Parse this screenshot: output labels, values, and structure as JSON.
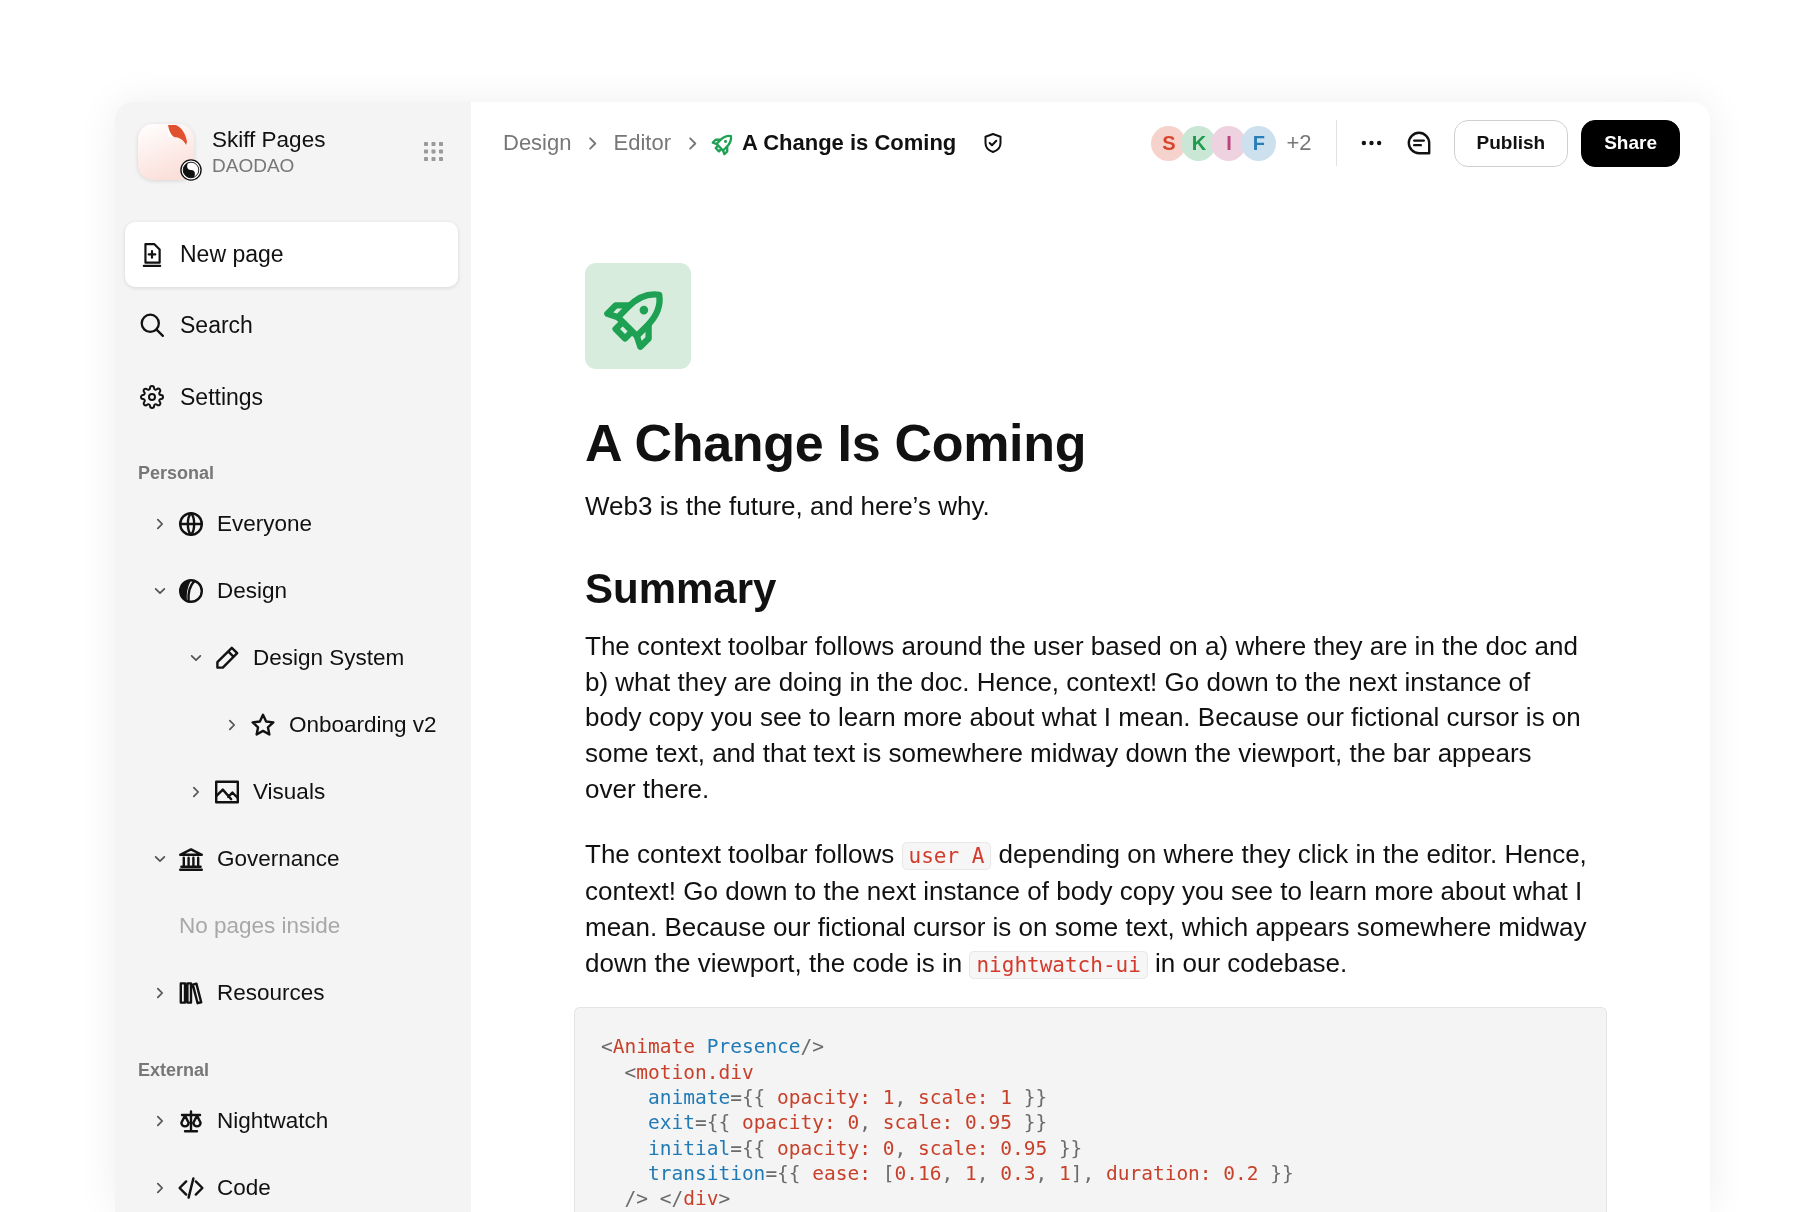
{
  "sidebar": {
    "workspace": {
      "name": "Skiff Pages",
      "org": "DAODAO"
    },
    "actions": [
      {
        "label": "New page",
        "kind": "card"
      },
      {
        "label": "Search",
        "kind": "plain"
      },
      {
        "label": "Settings",
        "kind": "plain"
      }
    ],
    "sections": [
      {
        "title": "Personal",
        "items": [
          {
            "label": "Everyone",
            "expanded": false
          },
          {
            "label": "Design",
            "expanded": true,
            "children": [
              {
                "label": "Design System",
                "expanded": true,
                "children": [
                  {
                    "label": "Onboarding v2",
                    "expanded": false
                  }
                ]
              },
              {
                "label": "Visuals",
                "expanded": false
              }
            ]
          },
          {
            "label": "Governance",
            "expanded": true,
            "empty_note": "No pages inside"
          },
          {
            "label": "Resources",
            "expanded": false
          }
        ]
      },
      {
        "title": "External",
        "items": [
          {
            "label": "Nightwatch",
            "expanded": false
          },
          {
            "label": "Code",
            "expanded": false
          }
        ]
      }
    ]
  },
  "topbar": {
    "breadcrumbs": [
      {
        "label": "Design",
        "current": false
      },
      {
        "label": "Editor",
        "current": false
      },
      {
        "label": "A Change is Coming",
        "current": true
      }
    ],
    "collaborators": [
      {
        "initial": "S",
        "color": "#d9452c"
      },
      {
        "initial": "K",
        "color": "#1e9a4c"
      },
      {
        "initial": "I",
        "color": "#b8447c"
      },
      {
        "initial": "F",
        "color": "#2b7db8"
      }
    ],
    "more_collaborators": "+2",
    "buttons": [
      {
        "label": "Publish",
        "kind": "outline"
      },
      {
        "label": "Share",
        "kind": "solid"
      }
    ]
  },
  "document": {
    "title": "A Change Is Coming",
    "subtitle": "Web3 is the future, and here’s why.",
    "heading": "Summary",
    "paragraphs": [
      {
        "segments": [
          {
            "kind": "text",
            "text": "The context toolbar follows around the user based on a) where they are in the doc and b) what they are doing in the doc. Hence, context! Go down to the next instance of body copy you see to learn more about what I mean. Because our fictional cursor is on some text, and that text is somewhere midway down the viewport, the bar appears over there."
          }
        ]
      },
      {
        "segments": [
          {
            "kind": "text",
            "text": "The context toolbar follows "
          },
          {
            "kind": "code",
            "text": "user A"
          },
          {
            "kind": "text",
            "text": " depending on where they click in the editor. Hence, context! Go down to the next instance of body copy you see to learn more about what I mean. Because our fictional cursor is on some text, which appears somewhere midway down the viewport, the code is in "
          },
          {
            "kind": "code",
            "text": "nightwatch-ui"
          },
          {
            "kind": "text",
            "text": " in our codebase."
          }
        ]
      }
    ],
    "code": [
      {
        "tokens": [
          {
            "kind": "punct",
            "text": "<"
          },
          {
            "kind": "tag",
            "text": "Animate"
          },
          {
            "kind": "attr",
            "text": " Presence"
          },
          {
            "kind": "punct",
            "text": "/>"
          }
        ]
      },
      {
        "tokens": [
          {
            "kind": "punct",
            "text": "  <"
          },
          {
            "kind": "tag",
            "text": "motion.div"
          }
        ]
      },
      {
        "tokens": [
          {
            "kind": "attr",
            "text": "    animate"
          },
          {
            "kind": "punct",
            "text": "={{ "
          },
          {
            "kind": "value",
            "text": "opacity: 1"
          },
          {
            "kind": "punct",
            "text": ", "
          },
          {
            "kind": "value",
            "text": "scale: 1"
          },
          {
            "kind": "punct",
            "text": " }}"
          }
        ]
      },
      {
        "tokens": [
          {
            "kind": "attr",
            "text": "    exit"
          },
          {
            "kind": "punct",
            "text": "={{ "
          },
          {
            "kind": "value",
            "text": "opacity: 0"
          },
          {
            "kind": "punct",
            "text": ", "
          },
          {
            "kind": "value",
            "text": "scale: 0.95"
          },
          {
            "kind": "punct",
            "text": " }}"
          }
        ]
      },
      {
        "tokens": [
          {
            "kind": "attr",
            "text": "    initial"
          },
          {
            "kind": "punct",
            "text": "={{ "
          },
          {
            "kind": "value",
            "text": "opacity: 0"
          },
          {
            "kind": "punct",
            "text": ", "
          },
          {
            "kind": "value",
            "text": "scale: 0.95"
          },
          {
            "kind": "punct",
            "text": " }}"
          }
        ]
      },
      {
        "tokens": [
          {
            "kind": "attr",
            "text": "    transition"
          },
          {
            "kind": "punct",
            "text": "={{ "
          },
          {
            "kind": "value",
            "text": "ease: "
          },
          {
            "kind": "punct",
            "text": "["
          },
          {
            "kind": "value",
            "text": "0.16"
          },
          {
            "kind": "punct",
            "text": ", "
          },
          {
            "kind": "value",
            "text": "1"
          },
          {
            "kind": "punct",
            "text": ", "
          },
          {
            "kind": "value",
            "text": "0.3"
          },
          {
            "kind": "punct",
            "text": ", "
          },
          {
            "kind": "value",
            "text": "1"
          },
          {
            "kind": "punct",
            "text": "], "
          },
          {
            "kind": "value",
            "text": "duration: 0.2"
          },
          {
            "kind": "punct",
            "text": " }}"
          }
        ]
      },
      {
        "tokens": [
          {
            "kind": "punct",
            "text": "  /> </"
          },
          {
            "kind": "tag",
            "text": "div"
          },
          {
            "kind": "punct",
            "text": ">"
          }
        ]
      }
    ]
  }
}
